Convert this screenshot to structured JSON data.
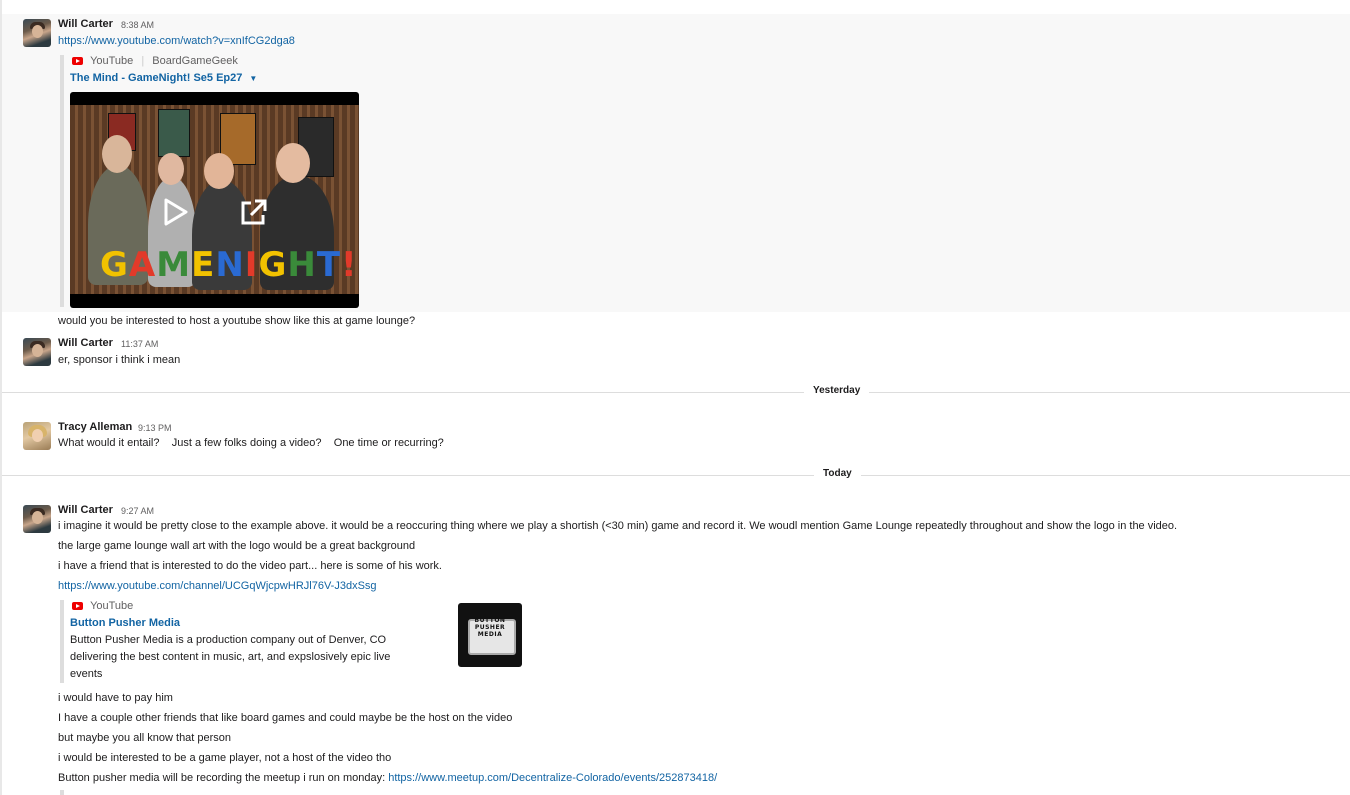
{
  "messages": {
    "m1": {
      "author": "Will Carter",
      "time": "8:38 AM",
      "link": "https://www.youtube.com/watch?v=xnIfCG2dga8"
    },
    "att1": {
      "service": "YouTube",
      "author": "BoardGameGeek",
      "title": "The Mind - GameNight! Se5 Ep27",
      "thumb_text": "GAMENIGHT!"
    },
    "m1b": "would you be interested to host a youtube show like this at game lounge?",
    "m2": {
      "author": "Will Carter",
      "time": "11:37 AM",
      "text": "er, sponsor i think i mean"
    },
    "divider_yesterday": "Yesterday",
    "m3": {
      "author": "Tracy Alleman",
      "time": "9:13 PM",
      "text": "What would it entail?    Just a few folks doing a video?    One time or recurring?"
    },
    "divider_today": "Today",
    "m4": {
      "author": "Will Carter",
      "time": "9:27 AM",
      "line1": "i imagine it would be pretty close to the example above. it would be a reoccuring thing where we play a shortish (<30 min) game and record it. We woudl mention Game Lounge repeatedly throughout and show the logo in the video.",
      "line2": "the large game lounge wall art with the logo would be a great background",
      "line3": "i have a friend that is interested to do the video part... here is some of his work.",
      "link": "https://www.youtube.com/channel/UCGqWjcpwHRJl76V-J3dxSsg"
    },
    "att2": {
      "service": "YouTube",
      "title": "Button Pusher Media",
      "desc1": "Button Pusher Media is a production company out of Denver, CO",
      "desc2": "delivering the best content in music, art, and expslosively epic live",
      "desc3": "events",
      "logo_line1": "BUTTON",
      "logo_line2": "PUSHER",
      "logo_line3": "MEDIA"
    },
    "m5": "i would have to pay him",
    "m6": "I have a couple other friends that like board games and could maybe be the host on the video",
    "m7": "but maybe you all know that person",
    "m8": "i would be interested to be a game player, not a host of the video tho",
    "m9": {
      "text": "Button pusher media will be recording the meetup i run on monday: ",
      "link": "https://www.meetup.com/Decentralize-Colorado/events/252873418/"
    }
  },
  "colors": {
    "link": "#1264a3",
    "highlight": "#f8f8f8",
    "youtube_red": "#ee0000"
  }
}
